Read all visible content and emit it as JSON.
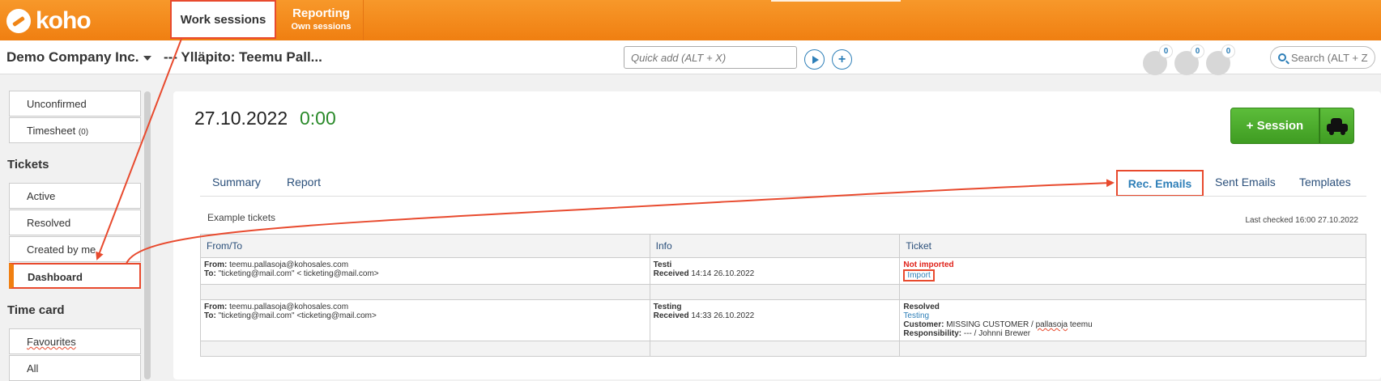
{
  "topbar": {
    "logo_text": "koho",
    "tab_work_sessions": "Work sessions",
    "tab_reporting_title": "Reporting",
    "tab_reporting_subtitle": "Own sessions"
  },
  "subbar": {
    "company": "Demo Company Inc.",
    "maintenance": "--- Ylläpito: Teemu Pall...",
    "quick_add_placeholder": "Quick add (ALT + X)",
    "notification_counts": [
      "0",
      "0",
      "0"
    ],
    "search_placeholder": "Search (ALT + Z)"
  },
  "sidebar": {
    "top_items": [
      {
        "label": "Unconfirmed"
      },
      {
        "label": "Timesheet",
        "count": "(0)"
      }
    ],
    "tickets_heading": "Tickets",
    "ticket_items": [
      {
        "label": "Active"
      },
      {
        "label": "Resolved"
      },
      {
        "label": "Created by me"
      },
      {
        "label": "Dashboard"
      }
    ],
    "timecard_heading": "Time card",
    "timecard_items": [
      {
        "label": "Favourites"
      },
      {
        "label": "All"
      }
    ]
  },
  "main": {
    "date": "27.10.2022",
    "duration": "0:00",
    "session_button": "+ Session",
    "tabs": {
      "summary": "Summary",
      "report": "Report",
      "rec_emails": "Rec. Emails",
      "sent_emails": "Sent Emails",
      "templates": "Templates"
    },
    "example_label": "Example tickets",
    "last_checked": "Last checked 16:00 27.10.2022",
    "table": {
      "headers": [
        "From/To",
        "Info",
        "Ticket"
      ],
      "rows": [
        {
          "from_label": "From:",
          "from": "teemu.pallasoja@kohosales.com",
          "to_label": "To:",
          "to": "\"ticketing@mail.com\" < ticketing@mail.com>",
          "info_title": "Testi",
          "received_label": "Received",
          "received": "14:14 26.10.2022",
          "status": "Not imported",
          "action": "Import"
        },
        {
          "from_label": "From:",
          "from": "teemu.pallasoja@kohosales.com",
          "to_label": "To:",
          "to": "\"ticketing@mail.com\" <ticketing@mail.com>",
          "info_title": "Testing",
          "received_label": "Received",
          "received": "14:33 26.10.2022",
          "status": "Resolved",
          "ticket_link": "Testing",
          "customer_label": "Customer:",
          "customer_prefix": "MISSING CUSTOMER /",
          "customer_name_marked": "pallasoja",
          "customer_suffix": "teemu",
          "responsibility_label": "Responsibility:",
          "responsibility": "--- / Johnni Brewer"
        }
      ]
    }
  },
  "colors": {
    "brand_orange": "#f07f11",
    "annotation_red": "#e84a2e",
    "session_green": "#4aa82b",
    "link_blue": "#2e7fb8"
  }
}
